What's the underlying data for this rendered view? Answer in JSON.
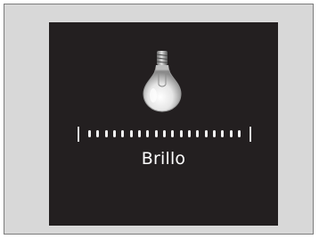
{
  "display": {
    "icon": "light-bulb-icon",
    "label": "Brillo",
    "brightness_level": 19,
    "brightness_max": 19
  },
  "colors": {
    "screen_background": "#231f20",
    "frame_background": "#d8d8d8",
    "text": "#ffffff"
  }
}
